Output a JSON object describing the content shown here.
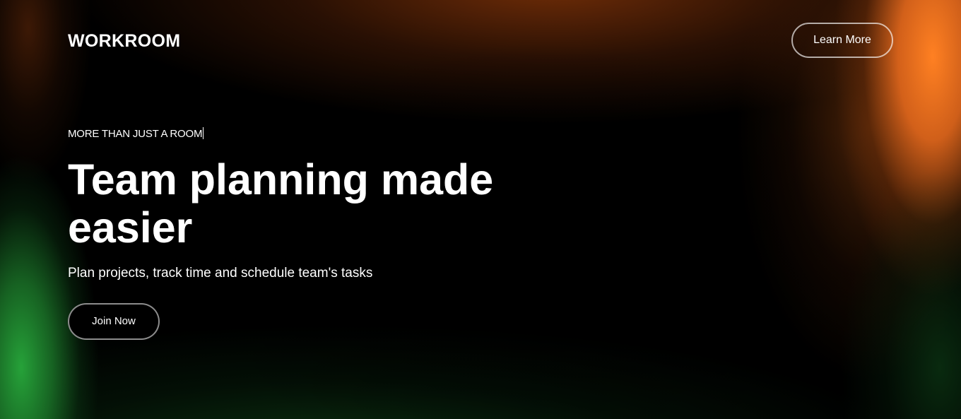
{
  "header": {
    "logo_text": "WORKROOM",
    "learn_more_label": "Learn More"
  },
  "hero": {
    "eyebrow": "MORE THAN JUST A ROOM",
    "headline": "Team planning made easier",
    "subheadline": "Plan projects, track time and schedule team's tasks",
    "join_now_label": "Join Now"
  },
  "colors": {
    "background": "#000000",
    "accent_orange": "#FF8022",
    "accent_green": "#28AA3C",
    "text": "#FFFFFF"
  }
}
